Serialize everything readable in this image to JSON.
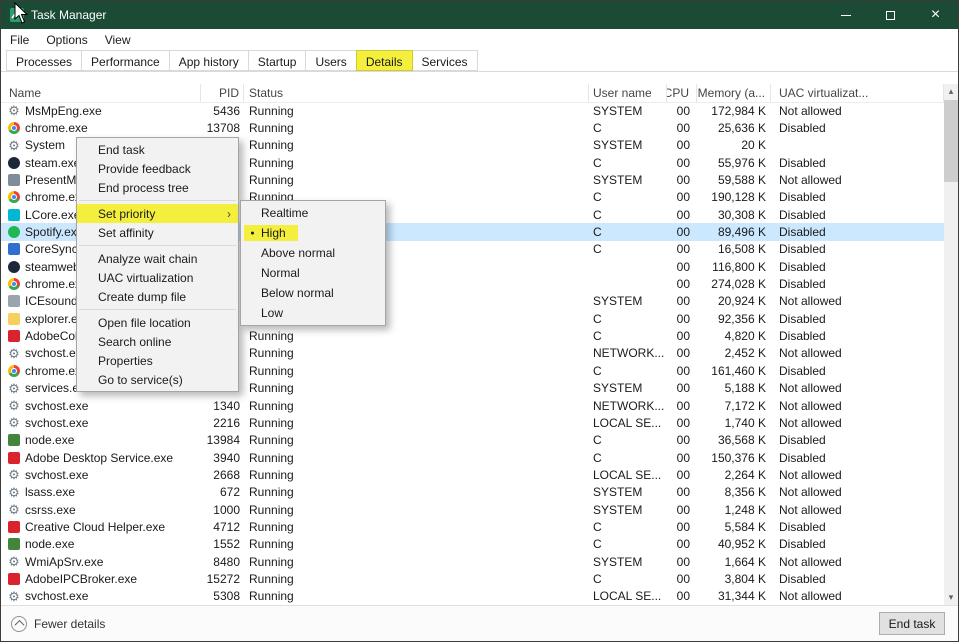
{
  "window": {
    "title": "Task Manager"
  },
  "menubar": {
    "items": [
      "File",
      "Options",
      "View"
    ]
  },
  "tabs": {
    "selected": "Details",
    "items": [
      "Processes",
      "Performance",
      "App history",
      "Startup",
      "Users",
      "Details",
      "Services"
    ]
  },
  "table": {
    "columns": [
      "Name",
      "PID",
      "Status",
      "User name",
      "CPU",
      "Memory (a...",
      "UAC virtualizat..."
    ],
    "rows": [
      {
        "icon": "gear-icon",
        "icon_color": "",
        "name": "MsMpEng.exe",
        "pid": "5436",
        "status": "Running",
        "user": "SYSTEM",
        "cpu": "00",
        "memory": "172,984 K",
        "uac": "Not allowed"
      },
      {
        "icon": "chrome-icon",
        "icon_color": "",
        "name": "chrome.exe",
        "pid": "13708",
        "status": "Running",
        "user": "C",
        "cpu": "00",
        "memory": "25,636 K",
        "uac": "Disabled"
      },
      {
        "icon": "gear-icon",
        "icon_color": "",
        "name": "System",
        "pid": "",
        "status": "Running",
        "user": "SYSTEM",
        "cpu": "00",
        "memory": "20 K",
        "uac": ""
      },
      {
        "icon": "steam-icon",
        "icon_color": "#1b2838",
        "name": "steam.exe",
        "pid": "",
        "status": "Running",
        "user": "C",
        "cpu": "00",
        "memory": "55,976 K",
        "uac": "Disabled"
      },
      {
        "icon": "app-icon",
        "icon_color": "#7f8c9a",
        "name": "PresentMo...",
        "pid": "",
        "status": "Running",
        "user": "SYSTEM",
        "cpu": "00",
        "memory": "59,588 K",
        "uac": "Not allowed"
      },
      {
        "icon": "chrome-icon",
        "icon_color": "",
        "name": "chrome.ex...",
        "pid": "",
        "status": "Running",
        "user": "C",
        "cpu": "00",
        "memory": "190,128 K",
        "uac": "Disabled"
      },
      {
        "icon": "logitech-icon",
        "icon_color": "#00b8d4",
        "name": "LCore.exe",
        "pid": "",
        "status": "",
        "user": "C",
        "cpu": "00",
        "memory": "30,308 K",
        "uac": "Disabled"
      },
      {
        "icon": "spotify-icon",
        "icon_color": "#1db954",
        "name": "Spotify.ex...",
        "pid": "",
        "status": "",
        "user": "C",
        "cpu": "00",
        "memory": "89,496 K",
        "uac": "Disabled",
        "selected": true
      },
      {
        "icon": "adobe-sync-icon",
        "icon_color": "#2e6fd0",
        "name": "CoreSync...",
        "pid": "",
        "status": "",
        "user": "C",
        "cpu": "00",
        "memory": "16,508 K",
        "uac": "Disabled"
      },
      {
        "icon": "steam-icon",
        "icon_color": "#1b2838",
        "name": "steamweb...",
        "pid": "",
        "status": "",
        "user": "",
        "cpu": "00",
        "memory": "116,800 K",
        "uac": "Disabled"
      },
      {
        "icon": "chrome-icon",
        "icon_color": "",
        "name": "chrome.ex...",
        "pid": "",
        "status": "",
        "user": "",
        "cpu": "00",
        "memory": "274,028 K",
        "uac": "Disabled"
      },
      {
        "icon": "audio-icon",
        "icon_color": "#9aa4ad",
        "name": "ICEsounds...",
        "pid": "",
        "status": "",
        "user": "SYSTEM",
        "cpu": "00",
        "memory": "20,924 K",
        "uac": "Not allowed"
      },
      {
        "icon": "folder-icon",
        "icon_color": "#f6cf5f",
        "name": "explorer.e...",
        "pid": "",
        "status": "",
        "user": "C",
        "cpu": "00",
        "memory": "92,356 K",
        "uac": "Disabled"
      },
      {
        "icon": "adobe-icon",
        "icon_color": "#d9232e",
        "name": "AdobeCol...",
        "pid": "",
        "status": "Running",
        "user": "C",
        "cpu": "00",
        "memory": "4,820 K",
        "uac": "Disabled"
      },
      {
        "icon": "gear-icon",
        "icon_color": "",
        "name": "svchost.ex...",
        "pid": "",
        "status": "Running",
        "user": "NETWORK...",
        "cpu": "00",
        "memory": "2,452 K",
        "uac": "Not allowed"
      },
      {
        "icon": "chrome-icon",
        "icon_color": "",
        "name": "chrome.ex...",
        "pid": "",
        "status": "Running",
        "user": "C",
        "cpu": "00",
        "memory": "161,460 K",
        "uac": "Disabled"
      },
      {
        "icon": "gear-icon",
        "icon_color": "",
        "name": "services.ex...",
        "pid": "",
        "status": "Running",
        "user": "SYSTEM",
        "cpu": "00",
        "memory": "5,188 K",
        "uac": "Not allowed"
      },
      {
        "icon": "gear-icon",
        "icon_color": "",
        "name": "svchost.exe",
        "pid": "1340",
        "status": "Running",
        "user": "NETWORK...",
        "cpu": "00",
        "memory": "7,172 K",
        "uac": "Not allowed"
      },
      {
        "icon": "gear-icon",
        "icon_color": "",
        "name": "svchost.exe",
        "pid": "2216",
        "status": "Running",
        "user": "LOCAL SE...",
        "cpu": "00",
        "memory": "1,740 K",
        "uac": "Not allowed"
      },
      {
        "icon": "node-icon",
        "icon_color": "#43853d",
        "name": "node.exe",
        "pid": "13984",
        "status": "Running",
        "user": "C",
        "cpu": "00",
        "memory": "36,568 K",
        "uac": "Disabled"
      },
      {
        "icon": "adobe-icon",
        "icon_color": "#d9232e",
        "name": "Adobe Desktop Service.exe",
        "pid": "3940",
        "status": "Running",
        "user": "C",
        "cpu": "00",
        "memory": "150,376 K",
        "uac": "Disabled"
      },
      {
        "icon": "gear-icon",
        "icon_color": "",
        "name": "svchost.exe",
        "pid": "2668",
        "status": "Running",
        "user": "LOCAL SE...",
        "cpu": "00",
        "memory": "2,264 K",
        "uac": "Not allowed"
      },
      {
        "icon": "gear-icon",
        "icon_color": "",
        "name": "lsass.exe",
        "pid": "672",
        "status": "Running",
        "user": "SYSTEM",
        "cpu": "00",
        "memory": "8,356 K",
        "uac": "Not allowed"
      },
      {
        "icon": "gear-icon",
        "icon_color": "",
        "name": "csrss.exe",
        "pid": "1000",
        "status": "Running",
        "user": "SYSTEM",
        "cpu": "00",
        "memory": "1,248 K",
        "uac": "Not allowed"
      },
      {
        "icon": "adobe-icon",
        "icon_color": "#d9232e",
        "name": "Creative Cloud Helper.exe",
        "pid": "4712",
        "status": "Running",
        "user": "C",
        "cpu": "00",
        "memory": "5,584 K",
        "uac": "Disabled"
      },
      {
        "icon": "node-icon",
        "icon_color": "#43853d",
        "name": "node.exe",
        "pid": "1552",
        "status": "Running",
        "user": "C",
        "cpu": "00",
        "memory": "40,952 K",
        "uac": "Disabled"
      },
      {
        "icon": "gear-icon",
        "icon_color": "",
        "name": "WmiApSrv.exe",
        "pid": "8480",
        "status": "Running",
        "user": "SYSTEM",
        "cpu": "00",
        "memory": "1,664 K",
        "uac": "Not allowed"
      },
      {
        "icon": "adobe-icon",
        "icon_color": "#d9232e",
        "name": "AdobeIPCBroker.exe",
        "pid": "15272",
        "status": "Running",
        "user": "C",
        "cpu": "00",
        "memory": "3,804 K",
        "uac": "Disabled"
      },
      {
        "icon": "gear-icon",
        "icon_color": "",
        "name": "svchost.exe",
        "pid": "5308",
        "status": "Running",
        "user": "LOCAL SE...",
        "cpu": "00",
        "memory": "31,344 K",
        "uac": "Not allowed"
      }
    ]
  },
  "context_menu": {
    "items": [
      {
        "label": "End task"
      },
      {
        "label": "Provide feedback"
      },
      {
        "label": "End process tree"
      },
      {
        "type": "separator"
      },
      {
        "label": "Set priority",
        "highlighted": true,
        "has_submenu": true
      },
      {
        "label": "Set affinity"
      },
      {
        "type": "separator"
      },
      {
        "label": "Analyze wait chain"
      },
      {
        "label": "UAC virtualization"
      },
      {
        "label": "Create dump file"
      },
      {
        "type": "separator"
      },
      {
        "label": "Open file location"
      },
      {
        "label": "Search online"
      },
      {
        "label": "Properties"
      },
      {
        "label": "Go to service(s)"
      }
    ]
  },
  "submenu": {
    "items": [
      {
        "label": "Realtime"
      },
      {
        "label": "High",
        "selected": true,
        "highlighted": true
      },
      {
        "label": "Above normal"
      },
      {
        "label": "Normal"
      },
      {
        "label": "Below normal"
      },
      {
        "label": "Low"
      }
    ]
  },
  "footer": {
    "fewer_details": "Fewer details",
    "end_task": "End task"
  },
  "colors": {
    "titlebar": "#1b4a35",
    "highlight_yellow": "#f3ef3c",
    "selected_row": "#cbe8ff",
    "menu_background": "#f2f2f2"
  }
}
